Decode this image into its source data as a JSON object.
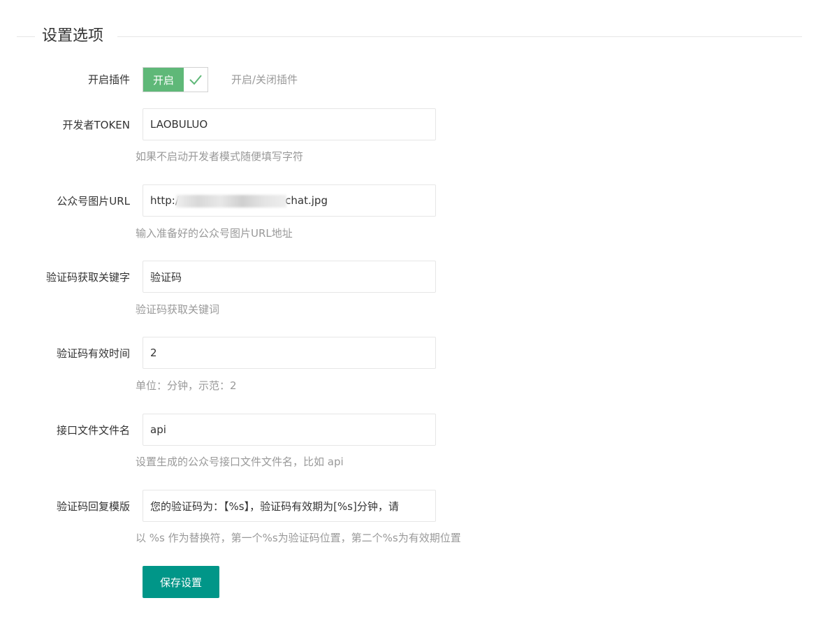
{
  "section": {
    "title": "设置选项"
  },
  "plugin_switch": {
    "label": "开启插件",
    "state_text": "开启",
    "hint": "开启/关闭插件",
    "on": true,
    "on_color": "#5fb878"
  },
  "fields": {
    "token": {
      "label": "开发者TOKEN",
      "value": "LAOBULUO",
      "hint": "如果不启动开发者模式随便填写字符"
    },
    "image_url": {
      "label": "公众号图片URL",
      "value": "http:/                              echat.jpg",
      "hint": "输入准备好的公众号图片URL地址"
    },
    "keyword": {
      "label": "验证码获取关键字",
      "value": "验证码",
      "hint": "验证码获取关键词"
    },
    "expire": {
      "label": "验证码有效时间",
      "value": "2",
      "hint": "单位：分钟，示范：2"
    },
    "api_file": {
      "label": "接口文件文件名",
      "value": "api",
      "hint": "设置生成的公众号接口文件文件名，比如 api"
    },
    "reply_template": {
      "label": "验证码回复模版",
      "value": "您的验证码为：【%s】，验证码有效期为[%s]分钟，请",
      "hint": "以 %s 作为替换符，第一个%s为验证码位置，第二个%s为有效期位置"
    }
  },
  "actions": {
    "save_label": "保存设置",
    "save_color": "#009688"
  }
}
